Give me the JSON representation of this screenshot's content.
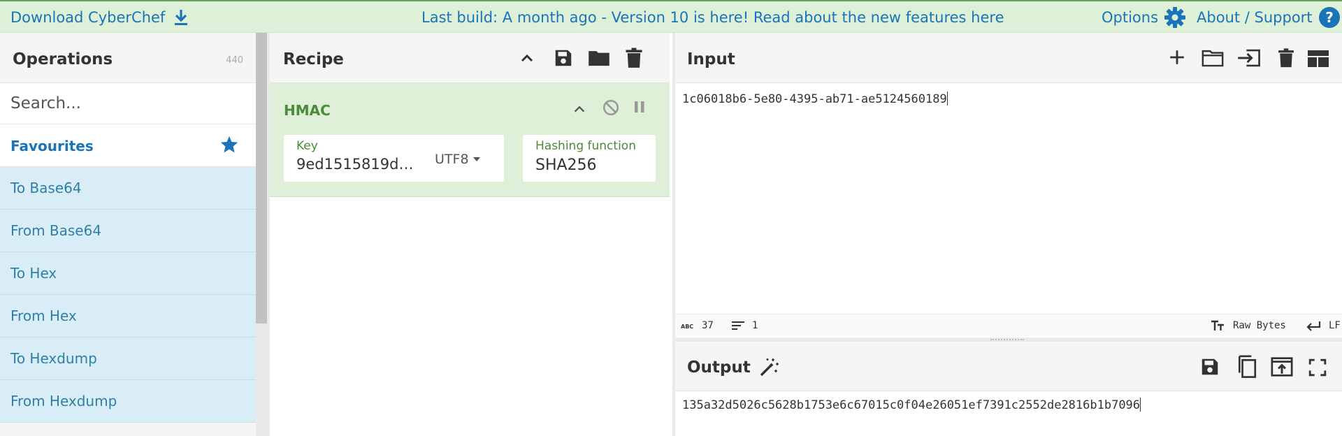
{
  "banner": {
    "download_label": "Download CyberChef",
    "notice": "Last build: A month ago - Version 10 is here! Read about the new features here",
    "options_label": "Options",
    "about_label": "About / Support"
  },
  "operations": {
    "title": "Operations",
    "count": "440",
    "search_placeholder": "Search...",
    "favourites_label": "Favourites",
    "items": [
      "To Base64",
      "From Base64",
      "To Hex",
      "From Hex",
      "To Hexdump",
      "From Hexdump"
    ]
  },
  "recipe": {
    "title": "Recipe",
    "operation": {
      "name": "HMAC",
      "key": {
        "label": "Key",
        "value": "9ed1515819d…",
        "encoding": "UTF8"
      },
      "hash": {
        "label": "Hashing function",
        "value": "SHA256"
      }
    }
  },
  "input": {
    "title": "Input",
    "text": "1c06018b6-5e80-4395-ab71-ae5124560189",
    "status": {
      "length": "37",
      "lines": "1",
      "encoding": "Raw Bytes",
      "eol": "LF"
    }
  },
  "output": {
    "title": "Output",
    "text": "135a32d5026c5628b1753e6c67015c0f04e26051ef7391c2552de2816b1b7096"
  },
  "colors": {
    "banner_bg": "#dff0d8",
    "link": "#1a74b8",
    "operation_bg": "#dff0d8",
    "operation_text": "#4a8a3a",
    "favourite_item_bg": "#d9edf7"
  }
}
